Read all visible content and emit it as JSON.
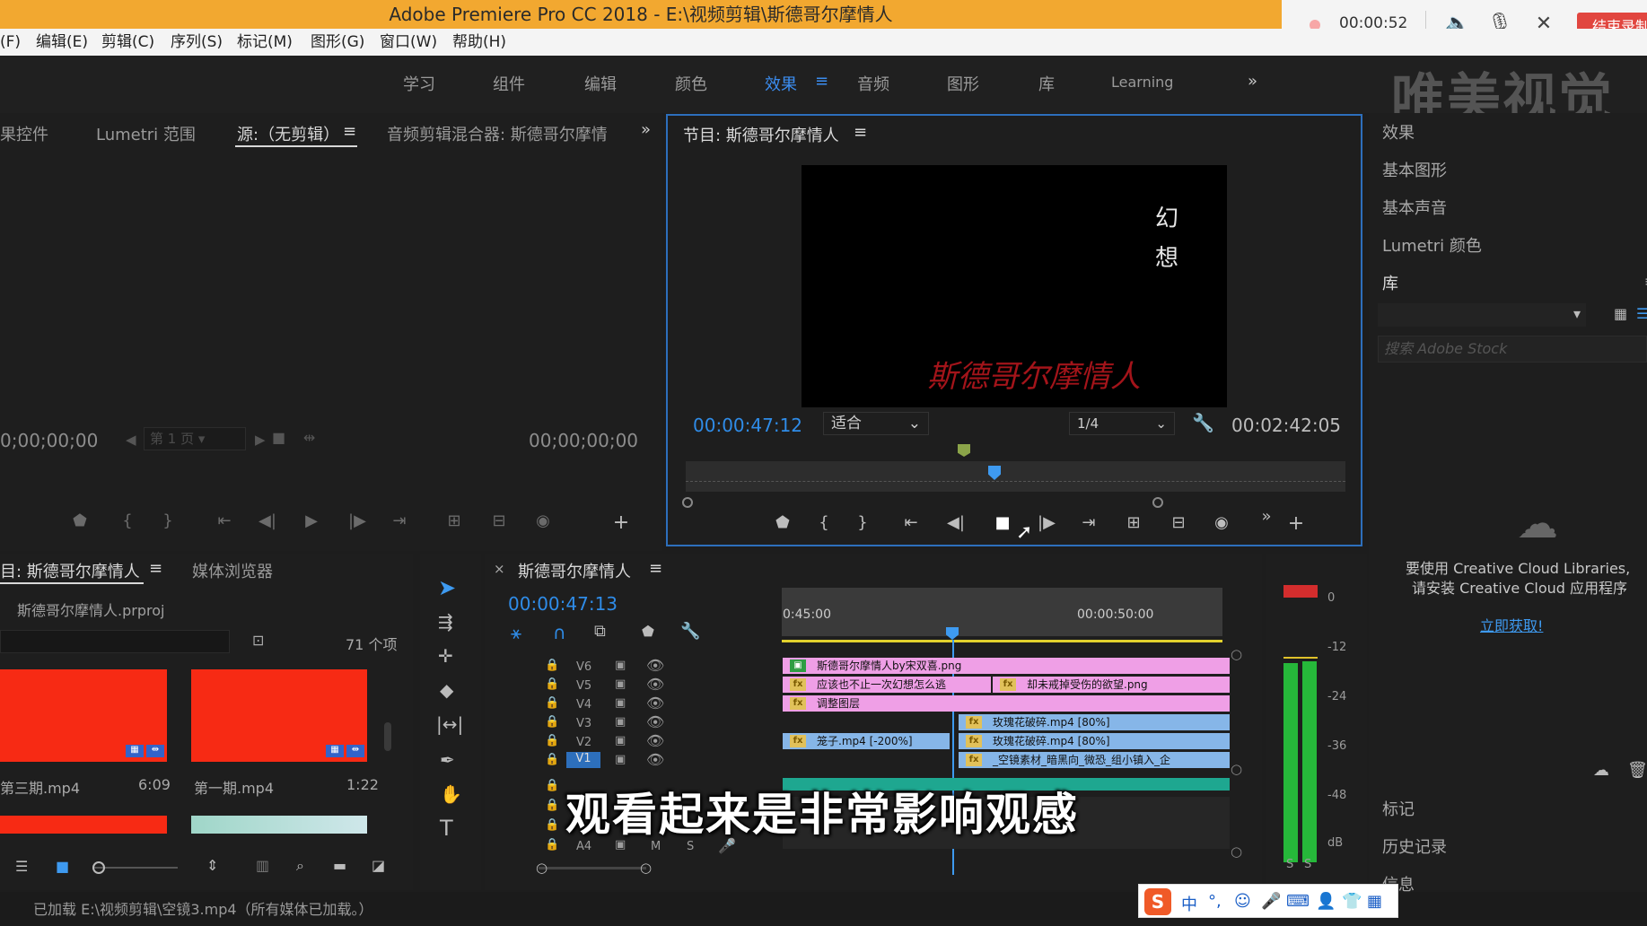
{
  "window": {
    "title": "Adobe Premiere Pro CC 2018 - E:\\视频剪辑\\斯德哥尔摩情人",
    "recording_time": "00:00:52",
    "end_recording_label": "结束录制"
  },
  "menu": [
    "(F)",
    "编辑(E)",
    "剪辑(C)",
    "序列(S)",
    "标记(M)",
    "图形(G)",
    "窗口(W)",
    "帮助(H)"
  ],
  "workspaces": {
    "tabs": [
      "学习",
      "组件",
      "编辑",
      "颜色",
      "效果",
      "音频",
      "图形",
      "库",
      "Learning"
    ],
    "active": "效果",
    "more": "»"
  },
  "watermark": "唯美视觉",
  "source_panel": {
    "tabs": [
      "果控件",
      "Lumetri 范围",
      "源:（无剪辑）",
      "音频剪辑混合器: 斯德哥尔摩情"
    ],
    "timecode_left": "0;00;00;00",
    "timecode_right": "00;00;00;00",
    "page": "第 1 页"
  },
  "program_panel": {
    "title": "节目: 斯德哥尔摩情人",
    "timecode": "00:00:47:12",
    "fit": "适合",
    "resolution": "1/4",
    "duration": "00:02:42:05",
    "preview_title_vertical": "幻想",
    "preview_caption": "斯德哥尔摩情人"
  },
  "project_panel": {
    "tabs": [
      "目: 斯德哥尔摩情人",
      "媒体浏览器"
    ],
    "file": "斯德哥尔摩情人.prproj",
    "item_count": "71 个项",
    "items": [
      {
        "name": "第三期.mp4",
        "duration": "6:09"
      },
      {
        "name": "第一期.mp4",
        "duration": "1:22"
      }
    ]
  },
  "timeline": {
    "title": "斯德哥尔摩情人",
    "timecode": "00:00:47:13",
    "ruler": [
      "0:45:00",
      "00:00:50:00"
    ],
    "tracks": [
      "V6",
      "V5",
      "V4",
      "V3",
      "V2",
      "V1",
      "A4"
    ],
    "clips": {
      "v6": "斯德哥尔摩情人by宋双喜.png",
      "v5a": "应该也不止一次幻想怎么逃",
      "v5b": "却未戒掉受伤的欲望.png",
      "v4": "调整图层",
      "v3": "玫瑰花破碎.mp4 [80%]",
      "v2a": "笼子.mp4 [-200%]",
      "v2b": "玫瑰花破碎.mp4 [80%]",
      "v1": "_空镜素材_暗黑向_微恐_组小镇入_企"
    },
    "a4_labels": [
      "M",
      "S"
    ]
  },
  "meter": {
    "scale": [
      "0",
      "-12",
      "-24",
      "-36",
      "-48",
      "dB"
    ],
    "solo": [
      "S",
      "S"
    ]
  },
  "right_panel": {
    "items": [
      "效果",
      "基本图形",
      "基本声音",
      "Lumetri 颜色",
      "库"
    ],
    "search_placeholder": "搜索 Adobe Stock",
    "cc_message_1": "要使用 Creative Cloud Libraries,",
    "cc_message_2": "请安装 Creative Cloud 应用程序",
    "cc_link": "立即获取!",
    "bottom_items": [
      "标记",
      "历史记录",
      "信息"
    ]
  },
  "subtitle": "观看起来是非常影响观感",
  "status": "已加载 E:\\视频剪辑\\空镜3.mp4（所有媒体已加载。）",
  "ime": {
    "logo": "S",
    "mode": "中"
  },
  "colors": {
    "accent": "#2f8ce8",
    "pink_clip": "#ef9fe6",
    "blue_clip": "#86b6e8",
    "red_thumb": "#f72a14"
  }
}
